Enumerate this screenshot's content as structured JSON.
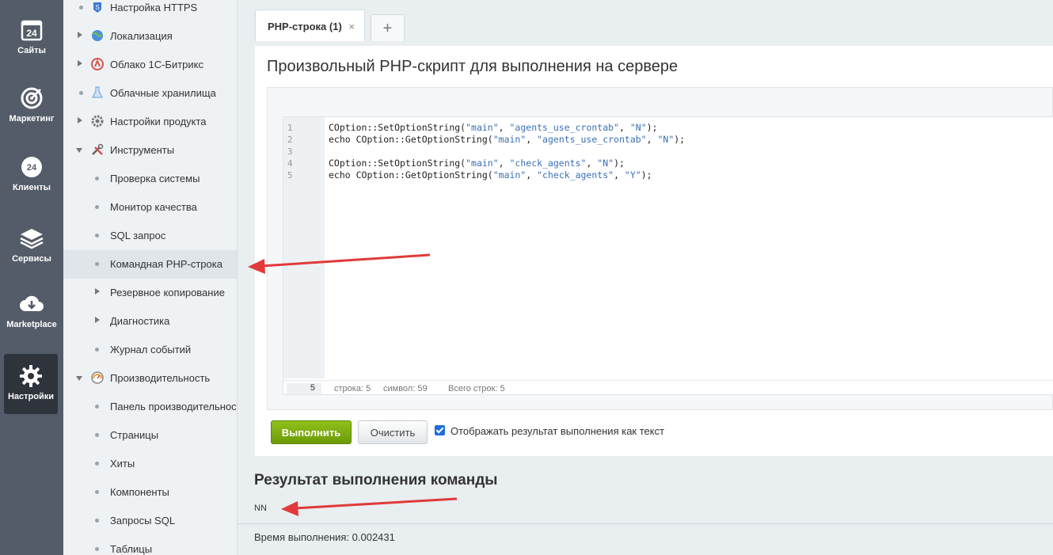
{
  "rail": {
    "items": [
      {
        "label": "Сайты",
        "icon": "sites-24-icon"
      },
      {
        "label": "Маркетинг",
        "icon": "target-icon"
      },
      {
        "label": "Клиенты",
        "icon": "clients-icon"
      },
      {
        "label": "Сервисы",
        "icon": "layers-icon"
      },
      {
        "label": "Marketplace",
        "icon": "cloud-download-icon"
      },
      {
        "label": "Настройки",
        "icon": "gear-icon"
      }
    ]
  },
  "tree": {
    "items": [
      {
        "label": "Настройка HTTPS",
        "type": "bullet-icon"
      },
      {
        "label": "Локализация",
        "type": "expand"
      },
      {
        "label": "Облако 1С-Битрикс",
        "type": "expand"
      },
      {
        "label": "Облачные хранилища",
        "type": "bullet-icon"
      },
      {
        "label": "Настройки продукта",
        "type": "expand"
      },
      {
        "label": "Инструменты",
        "type": "expanded"
      },
      {
        "label": "Проверка системы",
        "type": "child"
      },
      {
        "label": "Монитор качества",
        "type": "child"
      },
      {
        "label": "SQL запрос",
        "type": "child"
      },
      {
        "label": "Командная PHP-строка",
        "type": "child-selected"
      },
      {
        "label": "Резервное копирование",
        "type": "child-expand"
      },
      {
        "label": "Диагностика",
        "type": "child-expand"
      },
      {
        "label": "Журнал событий",
        "type": "child"
      },
      {
        "label": "Производительность",
        "type": "expanded"
      },
      {
        "label": "Панель производительности",
        "type": "child"
      },
      {
        "label": "Страницы",
        "type": "child"
      },
      {
        "label": "Хиты",
        "type": "child"
      },
      {
        "label": "Компоненты",
        "type": "child"
      },
      {
        "label": "Запросы SQL",
        "type": "child"
      },
      {
        "label": "Таблицы",
        "type": "child"
      }
    ]
  },
  "tabs": {
    "active_label": "PHP-строка (1)",
    "close_glyph": "×",
    "add_glyph": "+"
  },
  "panel": {
    "heading": "Произвольный PHP-скрипт для выполнения на сервере"
  },
  "editor": {
    "lines": [
      {
        "num": "1",
        "text": "COption::SetOptionString(\"main\", \"agents_use_crontab\", \"N\");"
      },
      {
        "num": "2",
        "text": "echo COption::GetOptionString(\"main\", \"agents_use_crontab\", \"N\");"
      },
      {
        "num": "3",
        "text": ""
      },
      {
        "num": "4",
        "text": "COption::SetOptionString(\"main\", \"check_agents\", \"N\");"
      },
      {
        "num": "5",
        "text": "echo COption::GetOptionString(\"main\", \"check_agents\", \"Y\");"
      }
    ],
    "status": {
      "current_line": "5",
      "line_info": "строка: 5",
      "symbol_info": "символ: 59",
      "total_info": "Всего строк: 5"
    }
  },
  "actions": {
    "run_label": "Выполнить",
    "clear_label": "Очистить",
    "checkbox_label": "Отображать результат выполнения как текст",
    "checkbox_checked": true
  },
  "result": {
    "title": "Результат выполнения команды",
    "output": "NN",
    "time": "Время выполнения: 0.002431"
  },
  "colors": {
    "rail_bg": "#545c69",
    "run_button": "#7aaa0c",
    "annotation_arrow": "#e03a3a"
  }
}
